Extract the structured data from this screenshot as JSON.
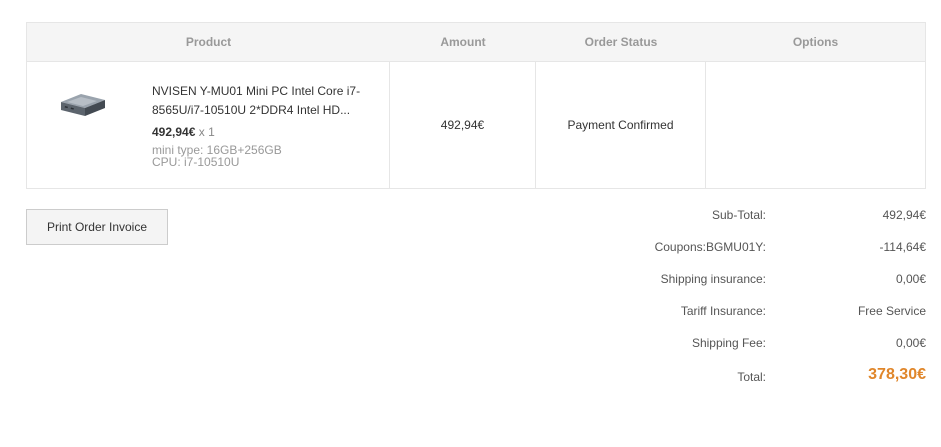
{
  "table": {
    "headers": {
      "product": "Product",
      "amount": "Amount",
      "status": "Order Status",
      "options": "Options"
    },
    "item": {
      "name": "NVISEN Y-MU01 Mini PC Intel Core i7-8565U/i7-10510U 2*DDR4 Intel HD...",
      "price": "492,94€",
      "qty": "x 1",
      "attr_mini_type": "mini type: 16GB+256GB",
      "attr_cpu": "CPU: i7-10510U",
      "amount": "492,94€",
      "status": "Payment Confirmed",
      "options": ""
    }
  },
  "actions": {
    "print_invoice": "Print Order Invoice"
  },
  "summary": {
    "subtotal_label": "Sub-Total:",
    "subtotal_value": "492,94€",
    "coupon_label": "Coupons:BGMU01Y:",
    "coupon_value": "-114,64€",
    "shipping_insurance_label": "Shipping insurance:",
    "shipping_insurance_value": "0,00€",
    "tariff_label": "Tariff Insurance:",
    "tariff_value": "Free Service",
    "shipping_fee_label": "Shipping Fee:",
    "shipping_fee_value": "0,00€",
    "total_label": "Total:",
    "total_value": "378,30€"
  },
  "colors": {
    "total_accent": "#e0862a"
  }
}
